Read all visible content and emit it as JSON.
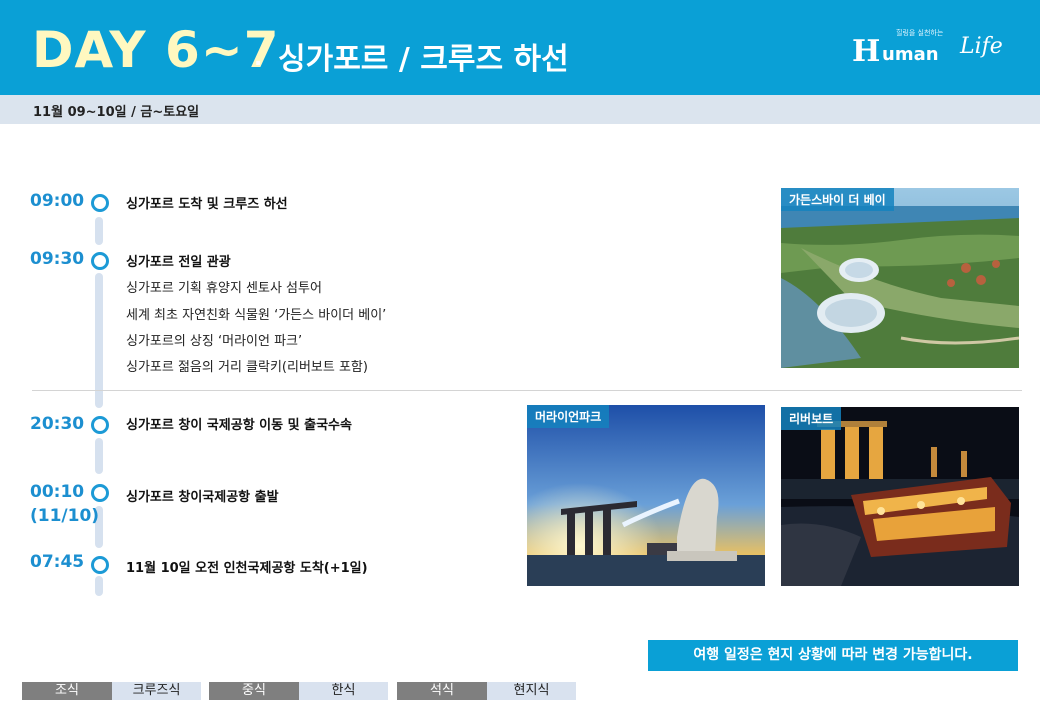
{
  "header": {
    "day": "DAY  6~7",
    "dot": ".",
    "subtitle": "싱가포르 / 크루즈 하선",
    "logo": {
      "tagline": "힐링을 실천하는",
      "letter": "H",
      "word": "uman",
      "script": "Life"
    }
  },
  "date_line": "11월 09~10일 / 금~토요일",
  "schedule": [
    {
      "time": "09:00",
      "title": "싱가포르 도착 및 크루즈 하선",
      "items": []
    },
    {
      "time": "09:30",
      "title": "싱가포르 전일 관광",
      "items": [
        "싱가포르 기획 휴양지 센토사 섬투어",
        "세계 최초 자연친화 식물원 ‘가든스 바이더 베이’",
        "싱가포르의 상징 ‘머라이언 파크’",
        "싱가포르 젊음의 거리 클락키(리버보트 포함)"
      ]
    },
    {
      "time": "20:30",
      "title": "싱가포르 창이 국제공항 이동 및 출국수속",
      "items": []
    },
    {
      "time": "00:10",
      "time_note": "(11/10)",
      "title": "싱가포르 창이국제공항 출발",
      "items": []
    },
    {
      "time": "07:45",
      "title": "11월 10일 오전 인천국제공항 도착(+1일)",
      "items": []
    }
  ],
  "photos": {
    "gardens": "가든스바이 더 베이",
    "merlion": "머라이언파크",
    "riverboat": "리버보트"
  },
  "notice": "여행 일정은 현지 상황에 따라 변경 가능합니다.",
  "meals": [
    {
      "label": "조식",
      "value": "크루즈식"
    },
    {
      "label": "중식",
      "value": "한식"
    },
    {
      "label": "석식",
      "value": "현지식"
    }
  ],
  "colors": {
    "header": "#0aa0d6",
    "title_yellow": "#fff8c0",
    "time_blue": "#1c8fd0",
    "date_bar": "#dbe4ee"
  }
}
